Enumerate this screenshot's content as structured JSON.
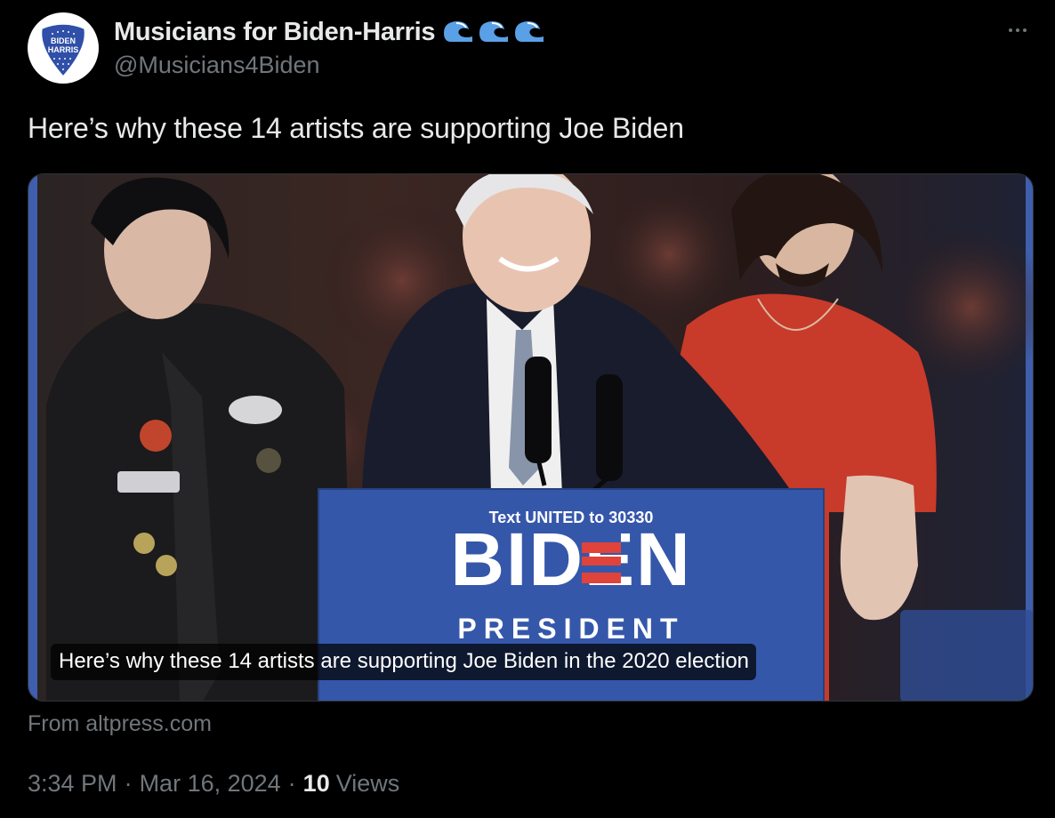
{
  "tweet": {
    "author": {
      "display_name": "Musicians for Biden-Harris",
      "handle": "@Musicians4Biden",
      "avatar_text_line1": "BIDEN",
      "avatar_text_line2": "HARRIS",
      "name_emojis": [
        "wave-icon",
        "wave-icon",
        "wave-icon"
      ]
    },
    "text": "Here’s why these 14 artists are supporting Joe Biden",
    "card": {
      "caption": "Here’s why these 14 artists are supporting Joe Biden in the 2020 election",
      "sign_text_top": "Text UNITED to 30330",
      "sign_text_brand": "BIDEN",
      "sign_text_bottom": "PRESIDENT",
      "source": "From altpress.com"
    },
    "meta": {
      "time": "3:34 PM",
      "separator": "·",
      "date": "Mar 16, 2024",
      "views_count": "10",
      "views_label": "Views"
    }
  },
  "colors": {
    "background": "#000000",
    "text_primary": "#e7e9ea",
    "text_secondary": "#71767b",
    "brand_blue": "#3a5db0",
    "brand_red": "#e0433a",
    "wave_blue": "#5aa0e6"
  }
}
